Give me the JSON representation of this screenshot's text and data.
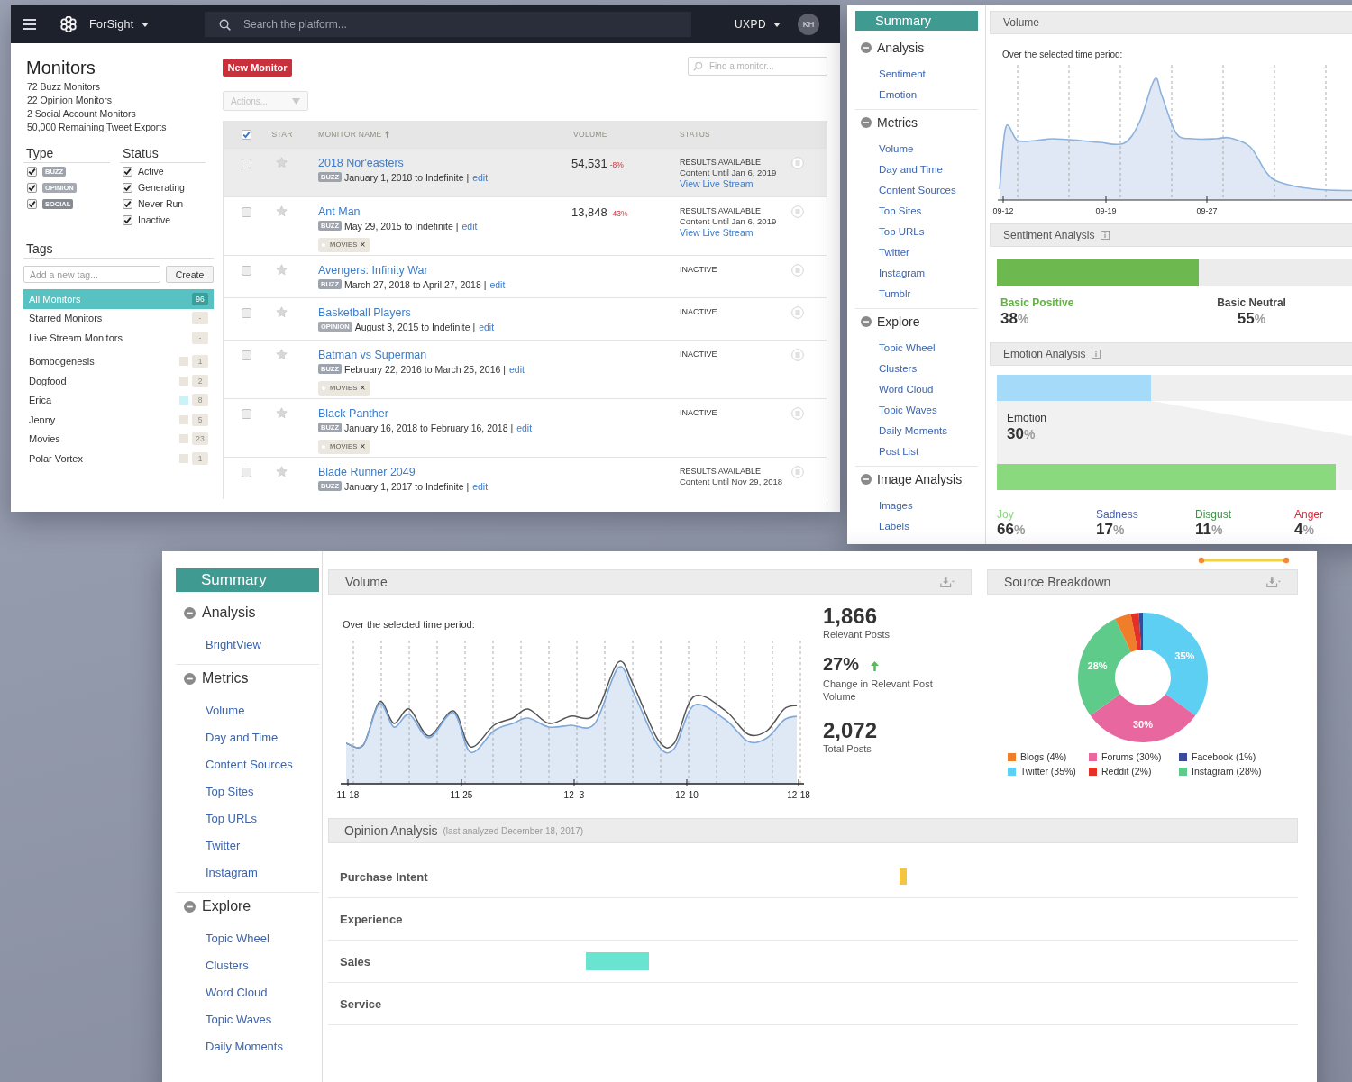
{
  "monitors_window": {
    "nav": {
      "brand": "ForSight",
      "search_placeholder": "Search the platform...",
      "account": "UXPD",
      "avatar": "KH"
    },
    "sidebar": {
      "title": "Monitors",
      "stats": [
        "72 Buzz Monitors",
        "22 Opinion Monitors",
        "2 Social Account Monitors",
        "50,000 Remaining Tweet Exports"
      ],
      "type_heading": "Type",
      "type_filters": [
        {
          "kind": "buzz",
          "label": "BUZZ",
          "checked": true
        },
        {
          "kind": "opinion",
          "label": "OPINION",
          "checked": true
        },
        {
          "kind": "social",
          "label": "SOCIAL",
          "checked": true
        }
      ],
      "status_heading": "Status",
      "status_filters": [
        {
          "label": "Active",
          "checked": true
        },
        {
          "label": "Generating",
          "checked": true
        },
        {
          "label": "Never Run",
          "checked": true
        },
        {
          "label": "Inactive",
          "checked": true
        }
      ],
      "tags_heading": "Tags",
      "tag_input_placeholder": "Add a new tag...",
      "create_button": "Create",
      "views": [
        {
          "label": "All Monitors",
          "count": "96",
          "selected": true
        },
        {
          "label": "Starred Monitors",
          "count": "-",
          "selected": false
        },
        {
          "label": "Live Stream Monitors",
          "count": "-",
          "selected": false
        }
      ],
      "tags": [
        {
          "label": "Bombogenesis",
          "count": "1",
          "color": "#ebe6dc"
        },
        {
          "label": "Dogfood",
          "count": "2",
          "color": "#ebe6dc"
        },
        {
          "label": "Erica",
          "count": "8",
          "color": "#c9f3f8"
        },
        {
          "label": "Jenny",
          "count": "5",
          "color": "#ebe6dc"
        },
        {
          "label": "Movies",
          "count": "23",
          "color": "#ebe6dc"
        },
        {
          "label": "Polar Vortex",
          "count": "1",
          "color": "#ebe6dc"
        }
      ]
    },
    "toolbar": {
      "new_monitor": "New Monitor",
      "actions": {
        "placeholder": "Actions...",
        "disabled": true
      },
      "find_placeholder": "Find a monitor..."
    },
    "table": {
      "select_all": {
        "checked": true
      },
      "columns": [
        {
          "label": "STAR",
          "sorted": false
        },
        {
          "label": "MONITOR NAME",
          "sorted": true
        },
        {
          "label": "VOLUME",
          "sorted": false
        },
        {
          "label": "STATUS",
          "sorted": false
        }
      ],
      "rows": [
        {
          "name": "2018 Nor'easters",
          "type": {
            "kind": "buzz",
            "label": "BUZZ"
          },
          "dates": "January 1, 2018 to Indefinite |",
          "edit": "edit",
          "volume": {
            "value": "54,531",
            "change": "-8%"
          },
          "status": {
            "kind": "results",
            "title": "RESULTS AVAILABLE",
            "detail": "Content Until Jan 6, 2019",
            "link": "View Live Stream"
          },
          "checked": false,
          "starred": false,
          "highlighted": true
        },
        {
          "name": "Ant Man",
          "type": {
            "kind": "buzz",
            "label": "BUZZ"
          },
          "dates": "May 29, 2015 to Indefinite |",
          "edit": "edit",
          "tags": [
            {
              "label": "MOVIES",
              "remove": "×"
            }
          ],
          "volume": {
            "value": "13,848",
            "change": "-43%"
          },
          "status": {
            "kind": "results",
            "title": "RESULTS AVAILABLE",
            "detail": "Content Until Jan 6, 2019",
            "link": "View Live Stream"
          },
          "checked": false,
          "starred": false,
          "highlighted": false
        },
        {
          "name": "Avengers: Infinity War",
          "type": {
            "kind": "buzz",
            "label": "BUZZ"
          },
          "dates": "March 27, 2018 to April 27, 2018 |",
          "edit": "edit",
          "status": {
            "kind": "inactive",
            "title": "INACTIVE"
          },
          "checked": false,
          "starred": false,
          "highlighted": false
        },
        {
          "name": "Basketball Players",
          "type": {
            "kind": "opinion",
            "label": "OPINION"
          },
          "dates": "August 3, 2015 to Indefinite |",
          "edit": "edit",
          "status": {
            "kind": "inactive",
            "title": "INACTIVE"
          },
          "checked": false,
          "starred": false,
          "highlighted": false
        },
        {
          "name": "Batman vs Superman",
          "type": {
            "kind": "buzz",
            "label": "BUZZ"
          },
          "dates": "February 22, 2016 to March 25, 2016 |",
          "edit": "edit",
          "tags": [
            {
              "label": "MOVIES",
              "remove": "×"
            }
          ],
          "status": {
            "kind": "inactive",
            "title": "INACTIVE"
          },
          "checked": false,
          "starred": false,
          "highlighted": false
        },
        {
          "name": "Black Panther",
          "type": {
            "kind": "buzz",
            "label": "BUZZ"
          },
          "dates": "January 16, 2018 to February 16, 2018 |",
          "edit": "edit",
          "tags": [
            {
              "label": "MOVIES",
              "remove": "×"
            }
          ],
          "status": {
            "kind": "inactive",
            "title": "INACTIVE"
          },
          "checked": false,
          "starred": false,
          "highlighted": false
        },
        {
          "name": "Blade Runner 2049",
          "type": {
            "kind": "buzz",
            "label": "BUZZ"
          },
          "dates": "January 1, 2017 to Indefinite |",
          "edit": "edit",
          "status": {
            "kind": "results",
            "title": "RESULTS AVAILABLE",
            "detail": "Content Until Nov 29, 2018"
          },
          "checked": false,
          "starred": false,
          "highlighted": false
        }
      ]
    }
  },
  "sentiment_window": {
    "summary": {
      "label": "Summary",
      "selected": true
    },
    "nav": [
      {
        "heading": "Analysis",
        "expanded": true,
        "items": [
          "Sentiment",
          "Emotion"
        ]
      },
      {
        "heading": "Metrics",
        "expanded": true,
        "items": [
          "Volume",
          "Day and Time",
          "Content Sources",
          "Top Sites",
          "Top URLs",
          "Twitter",
          "Instagram",
          "Tumblr"
        ]
      },
      {
        "heading": "Explore",
        "expanded": true,
        "items": [
          "Topic Wheel",
          "Clusters",
          "Word Cloud",
          "Topic Waves",
          "Daily Moments",
          "Post List"
        ]
      },
      {
        "heading": "Image Analysis",
        "expanded": true,
        "items": [
          "Images",
          "Labels"
        ]
      }
    ],
    "volume": {
      "title": "Volume",
      "caption": "Over the selected time period:",
      "x_labels": [
        "09-12",
        "09-19",
        "09-27"
      ]
    },
    "sentiment": {
      "title": "Sentiment Analysis",
      "segments": [
        {
          "kind": "positive",
          "label": "Basic Positive",
          "value": "38",
          "unit": "%",
          "level": 0.38
        },
        {
          "kind": "neutral",
          "label": "Basic Neutral",
          "value": "55",
          "unit": "%"
        }
      ]
    },
    "emotion": {
      "title": "Emotion Analysis",
      "overall": {
        "label": "Emotion",
        "value": "30",
        "unit": "%",
        "level": 0.3
      },
      "emotions": [
        {
          "label": "Joy",
          "value": "66",
          "unit": "%",
          "level": 0.66,
          "color": "#8ad97e"
        },
        {
          "label": "Sadness",
          "value": "17",
          "unit": "%",
          "color": "#4a62ad"
        },
        {
          "label": "Disgust",
          "value": "11",
          "unit": "%",
          "color": "#3f8f46"
        },
        {
          "label": "Anger",
          "value": "4",
          "unit": "%",
          "color": "#e3283b"
        }
      ]
    }
  },
  "volume_window": {
    "summary": {
      "label": "Summary",
      "selected": true
    },
    "nav": [
      {
        "heading": "Analysis",
        "expanded": true,
        "items": [
          "BrightView"
        ]
      },
      {
        "heading": "Metrics",
        "expanded": true,
        "items": [
          "Volume",
          "Day and Time",
          "Content Sources",
          "Top Sites",
          "Top URLs",
          "Twitter",
          "Instagram"
        ]
      },
      {
        "heading": "Explore",
        "expanded": true,
        "items": [
          "Topic Wheel",
          "Clusters",
          "Word Cloud",
          "Topic Waves",
          "Daily Moments"
        ]
      }
    ],
    "volume": {
      "title": "Volume",
      "caption": "Over the selected time period:",
      "x_labels": [
        "11-18",
        "11-25",
        "12- 3",
        "12-10",
        "12-18"
      ],
      "stats": [
        {
          "value": "1,866",
          "label": "Relevant Posts",
          "rising": false
        },
        {
          "value": "27%",
          "label": "Change in Relevant Post Volume",
          "rising": true
        },
        {
          "value": "2,072",
          "label": "Total Posts",
          "rising": false
        }
      ]
    },
    "source_breakdown": {
      "title": "Source Breakdown",
      "chart_data": {
        "type": "donut",
        "categories": [
          "Twitter (35%)",
          "Forums (30%)",
          "Instagram (28%)",
          "Blogs (4%)",
          "Reddit (2%)",
          "Facebook (1%)"
        ],
        "values": [
          35,
          30,
          28,
          4,
          2,
          1
        ],
        "colors": [
          "#5ccff2",
          "#e8679f",
          "#5fcb8b",
          "#f07d2a",
          "#e53027",
          "#3a4a98"
        ],
        "value_labels": [
          "35%",
          "30%",
          "28%",
          null,
          null,
          null
        ]
      }
    },
    "opinion": {
      "title": "Opinion Analysis",
      "note": "(last analyzed December 18, 2017)",
      "rows": [
        "Purchase Intent",
        "Experience",
        "Sales",
        "Service"
      ]
    }
  }
}
